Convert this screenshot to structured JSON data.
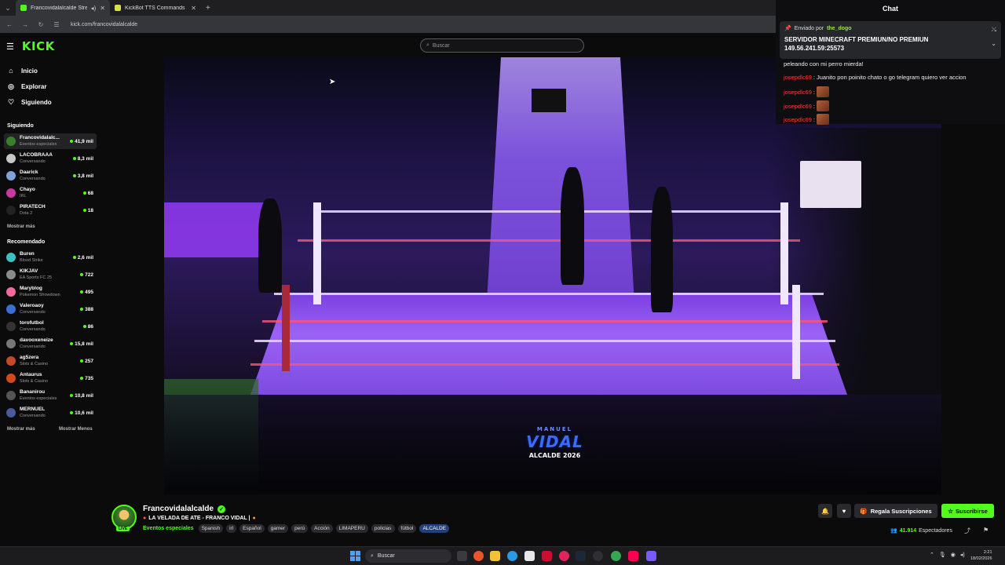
{
  "browser": {
    "tabs": [
      {
        "title": "Francovidalalcalde Stream",
        "active": true
      },
      {
        "title": "KickBot TTS Commands",
        "active": false
      }
    ],
    "url": "kick.com/francovidalalcalde"
  },
  "header": {
    "logo": "KICK",
    "search_placeholder": "Buscar"
  },
  "sidebar": {
    "nav": [
      {
        "label": "Inicio",
        "icon": "home-icon"
      },
      {
        "label": "Explorar",
        "icon": "compass-icon"
      },
      {
        "label": "Siguiendo",
        "icon": "heart-icon"
      }
    ],
    "following_title": "Siguiendo",
    "following": [
      {
        "name": "Francovidalalc...",
        "category": "Eventos especiales",
        "viewers": "41,9 mil",
        "color": "#3a7f2a"
      },
      {
        "name": "LACOBRAAA",
        "category": "Conversando",
        "viewers": "8,3 mil",
        "color": "#c7c7c7"
      },
      {
        "name": "Daarick",
        "category": "Conversando",
        "viewers": "3,8 mil",
        "color": "#7fa0d8"
      },
      {
        "name": "Chayo",
        "category": "IRL",
        "viewers": "68",
        "color": "#c73a9b"
      },
      {
        "name": "PIRATECH",
        "category": "Dota 2",
        "viewers": "18",
        "color": "#222222"
      }
    ],
    "show_more": "Mostrar más",
    "recommended_title": "Recomendado",
    "recommended": [
      {
        "name": "Buren",
        "category": "Blood Strike",
        "viewers": "2,6 mil",
        "color": "#3fc0c0"
      },
      {
        "name": "KIKJAV",
        "category": "EA Sports FC 25",
        "viewers": "722",
        "color": "#8b8b8b"
      },
      {
        "name": "Maryblog",
        "category": "Pokemon Showdown",
        "viewers": "495",
        "color": "#f06aa0"
      },
      {
        "name": "Valeroaoy",
        "category": "Conversando",
        "viewers": "388",
        "color": "#3a6fd0"
      },
      {
        "name": "torofutbol",
        "category": "Conversando",
        "viewers": "86",
        "color": "#333333"
      },
      {
        "name": "davooxeneize",
        "category": "Conversando",
        "viewers": "15,8 mil",
        "color": "#777777"
      },
      {
        "name": "ag5zera",
        "category": "Slots & Casino",
        "viewers": "257",
        "color": "#c04a2a"
      },
      {
        "name": "Antaurus",
        "category": "Slots & Casino",
        "viewers": "735",
        "color": "#d04a1a"
      },
      {
        "name": "Bananirou",
        "category": "Eventos especiales",
        "viewers": "10,8 mil",
        "color": "#555555"
      },
      {
        "name": "MERNUEL",
        "category": "Conversando",
        "viewers": "10,6 mil",
        "color": "#4a5a9a"
      }
    ],
    "show_more_2": "Mostrar más",
    "show_less": "Mostrar Menos"
  },
  "chat": {
    "title": "Chat",
    "pinned": {
      "sent_by_label": "Enviado por",
      "user": "the_dogo",
      "text_line1": "SERVIDOR MINECRAFT PREMIUN/NO PREMIUN",
      "text_line2": "149.56.241.59:25573"
    },
    "messages": [
      {
        "user": "",
        "text": "peleando con mi perro mierda!"
      },
      {
        "user": "josepdlc69",
        "text": "Juanito pon poinito chato o go telegram quiero ver accion"
      },
      {
        "user": "josepdlc69",
        "text": ""
      },
      {
        "user": "josepdlc69",
        "text": ""
      },
      {
        "user": "josepdlc69",
        "text": ""
      }
    ]
  },
  "video": {
    "overlay_pre": "MANUEL",
    "overlay_name": "VIDAL",
    "overlay_sub": "ALCALDE 2026"
  },
  "channel": {
    "name": "Francovidalalcalde",
    "live_label": "LIVE",
    "title": "LA VELADA DE ATE - FRANCO VIDAL |",
    "category": "Eventos especiales",
    "tags": [
      "Spanish",
      "irl",
      "Español",
      "gamer",
      "perú",
      "Acción",
      "LIMAPERU",
      "policias",
      "fútbol",
      "ALCALDE"
    ],
    "gift_label": "Regala Suscripciones",
    "subscribe_label": "Suscribirse",
    "viewers_count": "41.914",
    "viewers_label": "Espectadores"
  },
  "taskbar": {
    "search_label": "Buscar",
    "time": "2:21",
    "date": "18/02/2026"
  }
}
